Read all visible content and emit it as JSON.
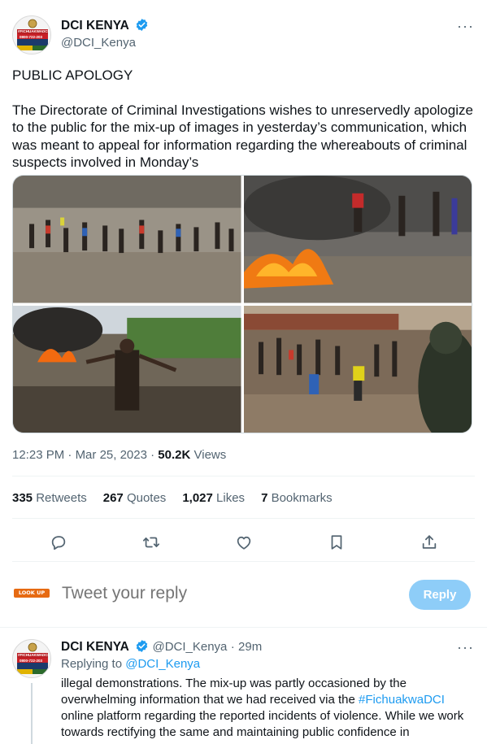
{
  "main_tweet": {
    "author_name": "DCI KENYA",
    "author_handle": "@DCI_Kenya",
    "text_heading": "PUBLIC APOLOGY",
    "text_body": "The Directorate of Criminal Investigations wishes to unreservedly apologize to the public for the mix-up of images in yesterday’s communication, which was meant to appeal for information regarding the whereabouts of criminal suspects involved in Monday’s",
    "time": "12:23 PM",
    "date": "Mar 25, 2023",
    "views_count": "50.2K",
    "views_label": "Views",
    "stats": {
      "retweets_count": "335",
      "retweets_label": "Retweets",
      "quotes_count": "267",
      "quotes_label": "Quotes",
      "likes_count": "1,027",
      "likes_label": "Likes",
      "bookmarks_count": "7",
      "bookmarks_label": "Bookmarks"
    },
    "avatar_text": {
      "tag": "#FICHUAKWADCI",
      "phone": "0800-722-203"
    }
  },
  "reply_box": {
    "user_logo_text": "LOOK UP TV",
    "placeholder": "Tweet your reply",
    "button_label": "Reply"
  },
  "thread_reply": {
    "author_name": "DCI KENYA",
    "author_handle": "@DCI_Kenya",
    "separator": "·",
    "time_ago": "29m",
    "replying_prefix": "Replying to",
    "replying_handle": "@DCI_Kenya",
    "body_part1": "illegal demonstrations. The mix-up was partly occasioned by the overwhelming information that we had received via the",
    "hashtag": "#FichuakwaDCI",
    "body_part2": "online platform regarding the reported incidents of violence. While we work towards rectifying the same and maintaining public confidence in"
  },
  "colors": {
    "accent": "#1d9bf0",
    "reply_button_disabled": "#8ecdf8",
    "muted_text": "#536471"
  },
  "icons": [
    "verified-badge-icon",
    "more-options-icon",
    "reply-icon",
    "retweet-icon",
    "like-icon",
    "bookmark-icon",
    "share-icon"
  ]
}
